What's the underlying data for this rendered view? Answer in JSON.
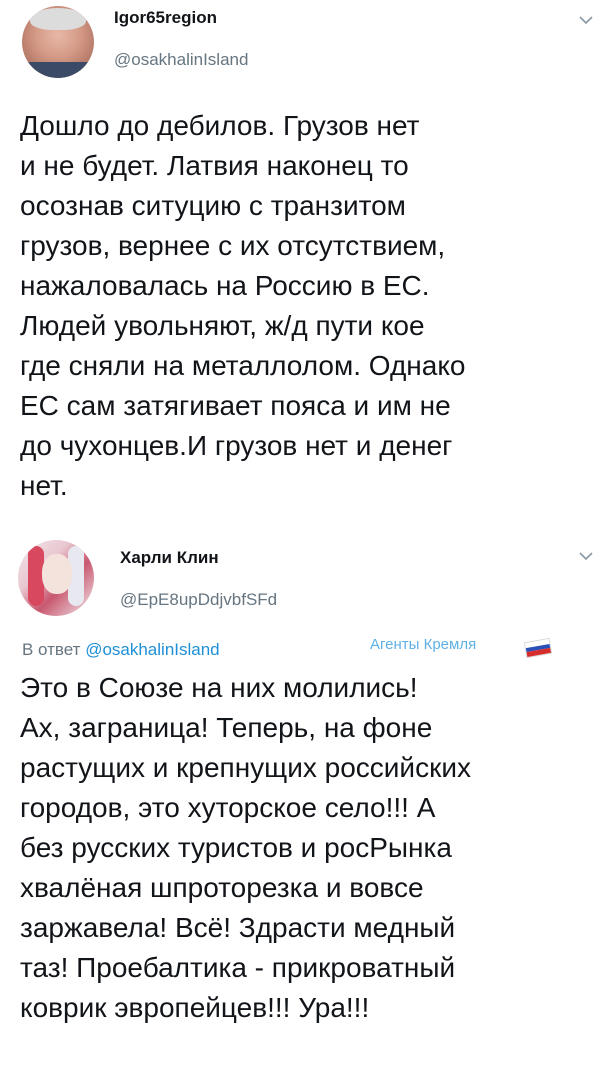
{
  "tweets": [
    {
      "display_name": "Igor65region",
      "handle": "@osakhalinIsland",
      "avatar_icon": "user-avatar-photo",
      "menu_icon": "chevron-down-icon",
      "text": "Дошло до дебилов. Грузов нет\nи не будет. Латвия наконец то\nосознав ситуцию с транзитом\nгрузов, вернее с их отсутствием,\nнажаловалась на Россию в ЕС.\nЛюдей увольняют, ж/д пути кое\nгде сняли на металлолом. Однако\nЕС сам затягивает пояса и им не\nдо чухонцев.И грузов нет и денег\nнет."
    },
    {
      "display_name": "Харли Клин",
      "handle": "@EpE8upDdjvbfSFd",
      "avatar_icon": "user-avatar-illustration",
      "menu_icon": "chevron-down-icon",
      "reply_prefix": "В ответ",
      "reply_mention": "@osakhalinIsland",
      "bot_label": "Агенты Кремля",
      "flag_icon": "russian-flag-icon",
      "text": "Это в Союзе на них молились!\nАх, заграница! Теперь, на фоне\nрастущих и крепнущих российских\nгородов, это хуторское село!!! А\nбез русских туристов и росРынка\nхвалёная шпроторезка и вовсе\nзаржавела! Всё! Здрасти медный\nтаз! Проебалтика - прикроватный\nковрик эвропейцев!!! Ура!!!"
    }
  ],
  "colors": {
    "text": "#111418",
    "secondary": "#667580",
    "link": "#1d8fd8",
    "badge": "#5fb0e6"
  }
}
